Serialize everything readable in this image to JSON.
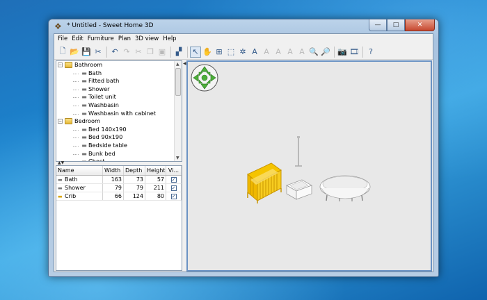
{
  "window": {
    "title": "* Untitled - Sweet Home 3D",
    "minimize_glyph": "—",
    "maximize_glyph": "□",
    "close_glyph": "✕"
  },
  "menu": [
    "File",
    "Edit",
    "Furniture",
    "Plan",
    "3D view",
    "Help"
  ],
  "toolbar": {
    "buttons": [
      {
        "name": "new-home-button",
        "glyph": "🗋",
        "enabled": true
      },
      {
        "name": "open-button",
        "glyph": "📂",
        "enabled": true
      },
      {
        "name": "save-button",
        "glyph": "💾",
        "enabled": true
      },
      {
        "name": "preferences-button",
        "glyph": "✂",
        "enabled": true
      },
      {
        "sep": true
      },
      {
        "name": "undo-button",
        "glyph": "↶",
        "enabled": true
      },
      {
        "name": "redo-button",
        "glyph": "↷",
        "enabled": false
      },
      {
        "name": "cut-button",
        "glyph": "✂",
        "enabled": false
      },
      {
        "name": "copy-button",
        "glyph": "❐",
        "enabled": false
      },
      {
        "name": "paste-button",
        "glyph": "▣",
        "enabled": false
      },
      {
        "sep": true
      },
      {
        "name": "add-furniture-button",
        "glyph": "▞",
        "enabled": true
      },
      {
        "sep": true
      },
      {
        "name": "select-mode-button",
        "glyph": "↖",
        "enabled": true,
        "active": true
      },
      {
        "name": "pan-mode-button",
        "glyph": "✋",
        "enabled": true
      },
      {
        "name": "create-walls-button",
        "glyph": "⊞",
        "enabled": true
      },
      {
        "name": "create-rooms-button",
        "glyph": "⬚",
        "enabled": true
      },
      {
        "name": "create-polylines-button",
        "glyph": "✲",
        "enabled": true
      },
      {
        "name": "add-text-button",
        "glyph": "A",
        "enabled": true
      },
      {
        "name": "modify-text-button-1",
        "glyph": "A",
        "enabled": false
      },
      {
        "name": "modify-text-button-2",
        "glyph": "A",
        "enabled": false
      },
      {
        "name": "modify-text-button-3",
        "glyph": "A",
        "enabled": false
      },
      {
        "name": "modify-text-button-4",
        "glyph": "A",
        "enabled": false
      },
      {
        "name": "zoom-in-button",
        "glyph": "🔍",
        "enabled": true
      },
      {
        "name": "zoom-out-button",
        "glyph": "🔎",
        "enabled": true
      },
      {
        "sep": true
      },
      {
        "name": "create-photo-button",
        "glyph": "📷",
        "enabled": true
      },
      {
        "name": "create-video-button",
        "glyph": "🎞",
        "enabled": true
      },
      {
        "sep": true
      },
      {
        "name": "help-button",
        "glyph": "?",
        "enabled": true
      }
    ]
  },
  "catalog": {
    "categories": [
      {
        "label": "Bathroom",
        "toggle": "−",
        "items": [
          "Bath",
          "Fitted bath",
          "Shower",
          "Toilet unit",
          "Washbasin",
          "Washbasin with cabinet"
        ]
      },
      {
        "label": "Bedroom",
        "toggle": "−",
        "items": [
          "Bed 140x190",
          "Bed 90x190",
          "Bedside table",
          "Bunk bed",
          "Chest"
        ]
      }
    ],
    "scroll_up": "▲",
    "scroll_down": "▼"
  },
  "splitter": {
    "up": "▲▼",
    "left": "◀"
  },
  "furniture_table": {
    "columns": [
      "Name",
      "Width",
      "Depth",
      "Height",
      "Vi..."
    ],
    "rows": [
      {
        "name": "Bath",
        "width": "163",
        "depth": "73",
        "height": "57",
        "visible": "✓"
      },
      {
        "name": "Shower",
        "width": "79",
        "depth": "79",
        "height": "211",
        "visible": "✓"
      },
      {
        "name": "Crib",
        "width": "66",
        "depth": "124",
        "height": "80",
        "visible": "✓"
      }
    ]
  },
  "colors": {
    "selection_yellow": "#e8b400",
    "nav_green": "#4caf3a",
    "view_border": "#6b93c4"
  }
}
